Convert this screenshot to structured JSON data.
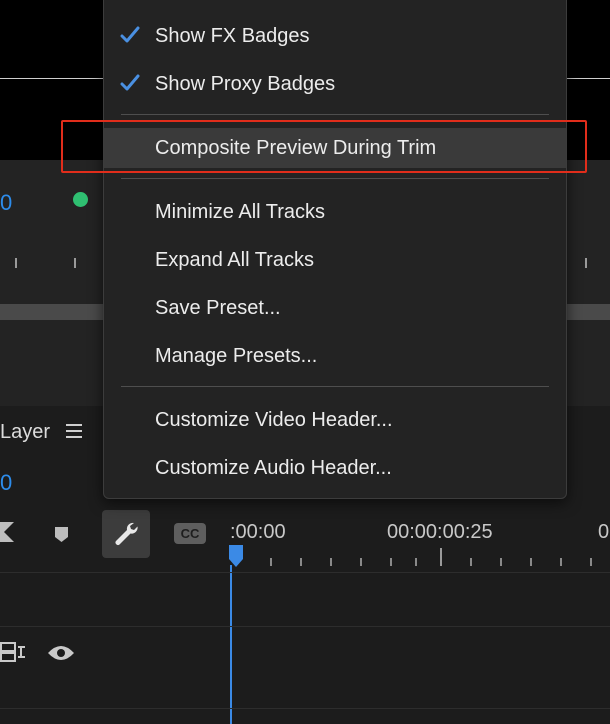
{
  "background": {
    "timecode_top": "0",
    "timecode_bottom": "0",
    "panel_label": "Layer"
  },
  "timeline": {
    "ruler_times": [
      ":00:00",
      "00:00:00:25",
      "0"
    ],
    "cc_label": "CC"
  },
  "menu": {
    "items": [
      {
        "label": "Show FX Badges",
        "checked": true
      },
      {
        "label": "Show Proxy Badges",
        "checked": true
      },
      {
        "label": "Composite Preview During Trim",
        "checked": false
      },
      {
        "label": "Minimize All Tracks",
        "checked": false
      },
      {
        "label": "Expand All Tracks",
        "checked": false
      },
      {
        "label": "Save Preset...",
        "checked": false
      },
      {
        "label": "Manage Presets...",
        "checked": false
      },
      {
        "label": "Customize Video Header...",
        "checked": false
      },
      {
        "label": "Customize Audio Header...",
        "checked": false
      }
    ]
  },
  "colors": {
    "accent_blue": "#2d8ceb",
    "highlight_red": "#e12d1b",
    "check_blue": "#4a90e2"
  }
}
